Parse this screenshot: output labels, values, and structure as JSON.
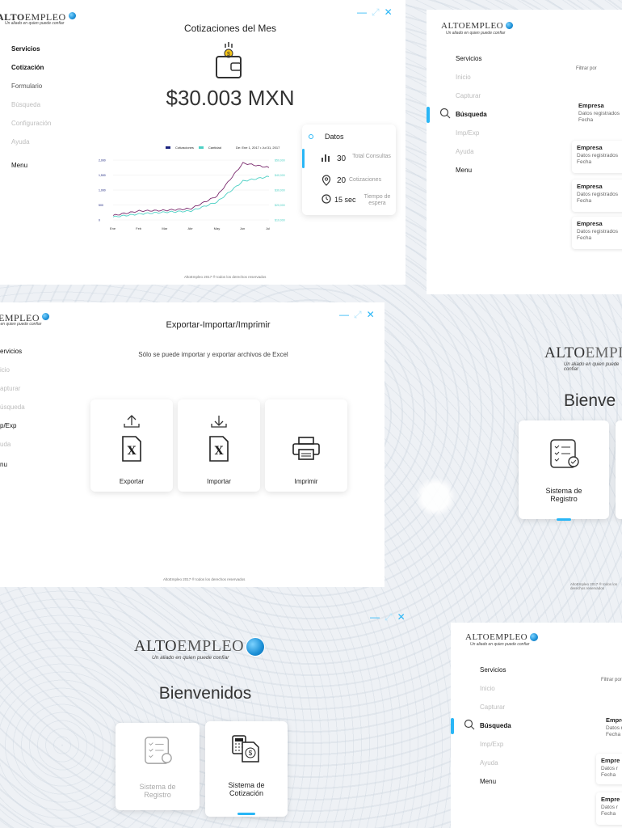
{
  "logo": {
    "alto": "ALTO",
    "empleo": "EMPLEO",
    "tagline": "Un aliado en quien puede confiar"
  },
  "window_controls": {
    "minimize": "—",
    "maximize": "⤢",
    "close": "✕"
  },
  "footer": "AltoEmpleo 2017 ® todos los derechos reservados",
  "cotizacion_screen": {
    "nav": [
      "Servicios",
      "Cotización",
      "Formulario",
      "Búsqueda",
      "Configuración",
      "Ayuda",
      "Menu"
    ],
    "title": "Cotizaciones del Mes",
    "amount": "$30.003 MXN",
    "legend": [
      "Cotizaciones",
      "Cantidad"
    ],
    "date_range": "De: Ene 1, 2017  •  Jul 31, 2017",
    "datos_label": "Datos",
    "stats": [
      {
        "value": "30",
        "label": "Total Consultas"
      },
      {
        "value": "20",
        "label": "Cotizaciones"
      },
      {
        "value": "15 sec",
        "label": "Tiempo de espera"
      }
    ],
    "x_ticks": [
      "Ene",
      "Feb",
      "Mar",
      "Abr",
      "May",
      "Jun",
      "Jul"
    ],
    "y_left": [
      "2,000",
      "1,500",
      "1,000",
      "500",
      "0"
    ],
    "y_right": [
      "$50,000",
      "$40,000",
      "$30,000",
      "$20,000",
      "$10,000"
    ]
  },
  "busqueda_screen": {
    "nav": [
      "Servicios",
      "Inicio",
      "Capturar",
      "Búsqueda",
      "Imp/Exp",
      "Ayuda",
      "Menu"
    ],
    "filter": "Filtrar por",
    "results": [
      {
        "title": "Empresa",
        "line1": "Datos registrados",
        "line2": "Fecha"
      },
      {
        "title": "Empresa",
        "line1": "Datos registrados",
        "line2": "Fecha"
      },
      {
        "title": "Empresa",
        "line1": "Datos registrados",
        "line2": "Fecha"
      },
      {
        "title": "Empresa",
        "line1": "Datos registrados",
        "line2": "Fecha"
      }
    ]
  },
  "export_screen": {
    "nav": [
      "ervicios",
      "icio",
      "apturar",
      "úsqueda",
      "p/Exp",
      "uda",
      "nu"
    ],
    "title": "Exportar-Importar/Imprimir",
    "note": "Sólo se puede importar y exportar archivos de Excel",
    "cards": [
      "Exportar",
      "Importar",
      "Imprimir"
    ]
  },
  "welcome_right": {
    "title": "Bienve",
    "card": "Sistema de Registro"
  },
  "welcome_main": {
    "title": "Bienvenidos",
    "cards": [
      "Sistema de Registro",
      "Sistema de Cotización"
    ]
  },
  "busqueda_bottom": {
    "nav": [
      "Servicios",
      "Inicio",
      "Capturar",
      "Búsqueda",
      "Imp/Exp",
      "Ayuda",
      "Menu"
    ],
    "filter": "Filtrar por",
    "results": [
      {
        "title": "Empre",
        "line1": "Datos r",
        "line2": "Fecha"
      },
      {
        "title": "Empre",
        "line1": "Datos r",
        "line2": "Fecha"
      },
      {
        "title": "Empre",
        "line1": "Datos r",
        "line2": "Fecha"
      }
    ]
  },
  "chart_data": {
    "type": "line",
    "title": "",
    "x": [
      "Ene",
      "Feb",
      "Mar",
      "Abr",
      "May",
      "Jun",
      "Jul"
    ],
    "series": [
      {
        "name": "Cotizaciones",
        "values": [
          150,
          300,
          320,
          380,
          800,
          1900,
          1750
        ]
      },
      {
        "name": "Cantidad",
        "values": [
          100,
          200,
          260,
          300,
          600,
          1300,
          1450
        ]
      }
    ],
    "xlabel": "",
    "ylabel": "",
    "ylim": [
      0,
      2000
    ],
    "colors": [
      "#7a2a6e",
      "#4dd0c4"
    ]
  }
}
